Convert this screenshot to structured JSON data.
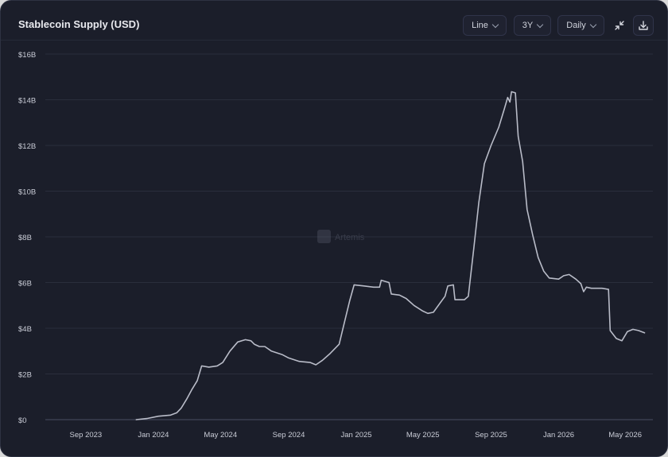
{
  "header": {
    "title": "Stablecoin Supply (USD)",
    "chart_type_label": "Line",
    "range_label": "3Y",
    "interval_label": "Daily"
  },
  "watermark": "Artemis",
  "colors": {
    "line": "#b9bcc8",
    "background": "#1b1e2a",
    "grid": "#2a2e3c"
  },
  "icons": [
    "collapse-icon",
    "download-icon",
    "chevron-down-icon"
  ],
  "chart_data": {
    "type": "line",
    "title": "Stablecoin Supply (USD)",
    "xlabel": "",
    "ylabel": "",
    "ylim": [
      0,
      16
    ],
    "yunit": "billions USD",
    "y_ticks": [
      {
        "value": 0,
        "label": "$0"
      },
      {
        "value": 2,
        "label": "$2B"
      },
      {
        "value": 4,
        "label": "$4B"
      },
      {
        "value": 6,
        "label": "$6B"
      },
      {
        "value": 8,
        "label": "$8B"
      },
      {
        "value": 10,
        "label": "$10B"
      },
      {
        "value": 12,
        "label": "$12B"
      },
      {
        "value": 14,
        "label": "$14B"
      },
      {
        "value": 16,
        "label": "$16B"
      }
    ],
    "x_range": [
      "2023-06-20",
      "2026-06-20"
    ],
    "x_ticks": [
      {
        "date": "2023-09-01",
        "label": "Sep 2023"
      },
      {
        "date": "2024-01-01",
        "label": "Jan 2024"
      },
      {
        "date": "2024-05-01",
        "label": "May 2024"
      },
      {
        "date": "2024-09-01",
        "label": "Sep 2024"
      },
      {
        "date": "2025-01-01",
        "label": "Jan 2025"
      },
      {
        "date": "2025-05-01",
        "label": "May 2025"
      },
      {
        "date": "2025-09-01",
        "label": "Sep 2025"
      },
      {
        "date": "2026-01-01",
        "label": "Jan 2026"
      },
      {
        "date": "2026-05-01",
        "label": "May 2026"
      }
    ],
    "grid": true,
    "legend": "none",
    "series": [
      {
        "points": [
          [
            "2023-12-01",
            0.0
          ],
          [
            "2023-12-20",
            0.05
          ],
          [
            "2024-01-10",
            0.15
          ],
          [
            "2024-02-01",
            0.2
          ],
          [
            "2024-02-12",
            0.3
          ],
          [
            "2024-02-20",
            0.5
          ],
          [
            "2024-03-01",
            0.9
          ],
          [
            "2024-03-10",
            1.3
          ],
          [
            "2024-03-20",
            1.7
          ],
          [
            "2024-03-28",
            2.35
          ],
          [
            "2024-04-10",
            2.3
          ],
          [
            "2024-04-25",
            2.35
          ],
          [
            "2024-05-05",
            2.5
          ],
          [
            "2024-05-18",
            3.0
          ],
          [
            "2024-06-01",
            3.4
          ],
          [
            "2024-06-15",
            3.5
          ],
          [
            "2024-06-25",
            3.45
          ],
          [
            "2024-07-01",
            3.3
          ],
          [
            "2024-07-10",
            3.2
          ],
          [
            "2024-07-20",
            3.2
          ],
          [
            "2024-08-01",
            3.0
          ],
          [
            "2024-08-20",
            2.85
          ],
          [
            "2024-09-01",
            2.7
          ],
          [
            "2024-09-20",
            2.55
          ],
          [
            "2024-10-10",
            2.5
          ],
          [
            "2024-10-20",
            2.4
          ],
          [
            "2024-11-01",
            2.6
          ],
          [
            "2024-11-15",
            2.9
          ],
          [
            "2024-12-01",
            3.3
          ],
          [
            "2024-12-10",
            4.2
          ],
          [
            "2024-12-20",
            5.2
          ],
          [
            "2024-12-28",
            5.9
          ],
          [
            "2025-01-15",
            5.85
          ],
          [
            "2025-02-01",
            5.8
          ],
          [
            "2025-02-12",
            5.8
          ],
          [
            "2025-02-15",
            6.1
          ],
          [
            "2025-03-01",
            6.0
          ],
          [
            "2025-03-05",
            5.5
          ],
          [
            "2025-03-20",
            5.45
          ],
          [
            "2025-04-01",
            5.3
          ],
          [
            "2025-04-15",
            5.0
          ],
          [
            "2025-05-01",
            4.75
          ],
          [
            "2025-05-10",
            4.65
          ],
          [
            "2025-05-20",
            4.7
          ],
          [
            "2025-06-01",
            5.1
          ],
          [
            "2025-06-10",
            5.4
          ],
          [
            "2025-06-15",
            5.85
          ],
          [
            "2025-06-25",
            5.9
          ],
          [
            "2025-06-28",
            5.25
          ],
          [
            "2025-07-15",
            5.25
          ],
          [
            "2025-07-22",
            5.4
          ],
          [
            "2025-08-01",
            7.5
          ],
          [
            "2025-08-10",
            9.5
          ],
          [
            "2025-08-20",
            11.2
          ],
          [
            "2025-09-01",
            12.0
          ],
          [
            "2025-09-15",
            12.8
          ],
          [
            "2025-09-25",
            13.6
          ],
          [
            "2025-10-01",
            14.1
          ],
          [
            "2025-10-05",
            13.9
          ],
          [
            "2025-10-08",
            14.35
          ],
          [
            "2025-10-15",
            14.3
          ],
          [
            "2025-10-20",
            12.4
          ],
          [
            "2025-10-28",
            11.3
          ],
          [
            "2025-11-05",
            9.2
          ],
          [
            "2025-11-15",
            8.1
          ],
          [
            "2025-11-25",
            7.1
          ],
          [
            "2025-12-05",
            6.5
          ],
          [
            "2025-12-15",
            6.2
          ],
          [
            "2026-01-01",
            6.15
          ],
          [
            "2026-01-10",
            6.3
          ],
          [
            "2026-01-20",
            6.35
          ],
          [
            "2026-02-01",
            6.15
          ],
          [
            "2026-02-10",
            5.95
          ],
          [
            "2026-02-15",
            5.6
          ],
          [
            "2026-02-20",
            5.8
          ],
          [
            "2026-03-01",
            5.75
          ],
          [
            "2026-03-20",
            5.75
          ],
          [
            "2026-04-01",
            5.7
          ],
          [
            "2026-04-04",
            3.9
          ],
          [
            "2026-04-15",
            3.55
          ],
          [
            "2026-04-25",
            3.45
          ],
          [
            "2026-05-05",
            3.85
          ],
          [
            "2026-05-15",
            3.95
          ],
          [
            "2026-05-25",
            3.9
          ],
          [
            "2026-06-05",
            3.8
          ]
        ]
      }
    ]
  }
}
